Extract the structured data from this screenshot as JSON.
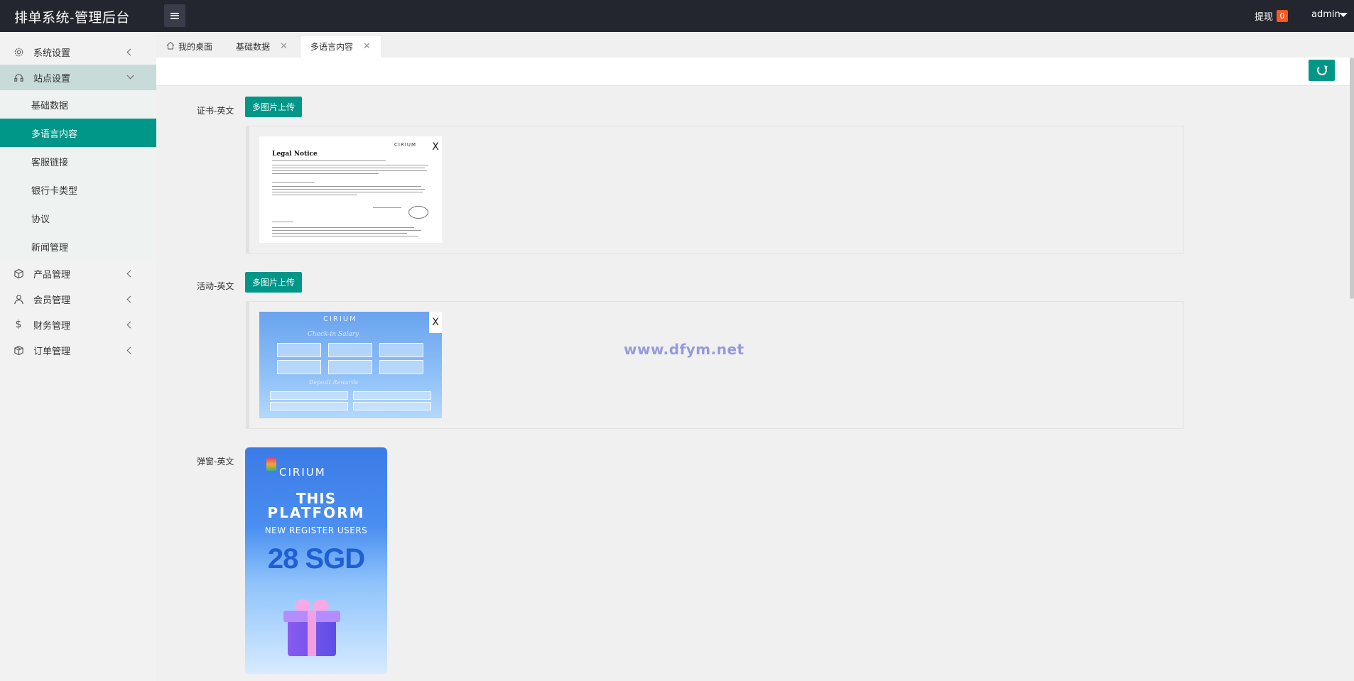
{
  "header": {
    "title": "排单系统-管理后台",
    "withdraw_label": "提现",
    "withdraw_count": "0",
    "user_name": "admin"
  },
  "sidebar": {
    "items": [
      {
        "label": "系统设置",
        "icon": "gear-icon"
      },
      {
        "label": "站点设置",
        "icon": "headset-icon"
      },
      {
        "label": "产品管理",
        "icon": "cube-icon"
      },
      {
        "label": "会员管理",
        "icon": "user-icon"
      },
      {
        "label": "财务管理",
        "icon": "dollar-icon"
      },
      {
        "label": "订单管理",
        "icon": "box-icon"
      }
    ],
    "sub_items": [
      "基础数据",
      "多语言内容",
      "客服链接",
      "银行卡类型",
      "协议",
      "新闻管理"
    ]
  },
  "tabs": [
    {
      "label": "我的桌面",
      "icon": "home-icon"
    },
    {
      "label": "基础数据"
    },
    {
      "label": "多语言内容"
    }
  ],
  "form": {
    "upload_label": "多图片上传",
    "delete_label": "X",
    "certificate": {
      "label": "证书-英文",
      "image_title": "Legal Notice",
      "image_logo": "CIRIUM"
    },
    "activity": {
      "label": "活动-英文",
      "image_logo": "CIRIUM",
      "image_heading": "Check-in Salary",
      "image_subheading": "Deposit Rewards"
    },
    "popup": {
      "label": "弹窗-英文",
      "image_logo": "CIRIUM",
      "line1": "THIS",
      "line2": "PLATFORM",
      "line3": "NEW REGISTER USERS",
      "amount": "28 SGD"
    }
  },
  "watermark": "www.dfym.net",
  "colors": {
    "header_bg": "#23262e",
    "accent": "#009688",
    "badge": "#ff5722"
  }
}
